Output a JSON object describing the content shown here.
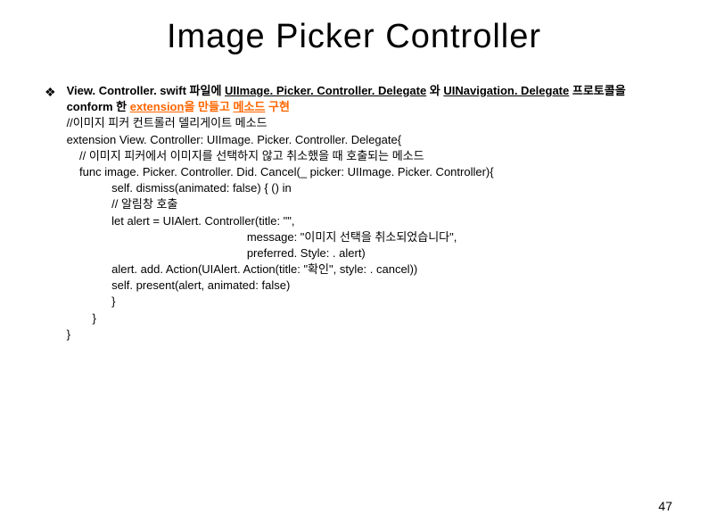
{
  "title": "Image Picker Controller",
  "bullet_char": "❖",
  "header": {
    "part1": "View. Controller. swift 파일에 ",
    "part2": "UIImage. Picker. Controller. Delegate",
    "part3": " 와 ",
    "part4": "UINavigation. Delegate",
    "part5": " 프로토콜을",
    "line2_part1": "conform 한 ",
    "line2_part2": "extension",
    "line2_part3": "을 만들고 ",
    "line2_part4": "메소드",
    "line2_part5": " 구현"
  },
  "code": {
    "line1": "//이미지 피커 컨트롤러 델리게이트 메소드",
    "line2": "extension View. Controller: UIImage. Picker. Controller. Delegate{",
    "line3": "    // 이미지 피커에서 이미지를 선택하지 않고 취소했을 때 호출되는 메소드",
    "line4": "    func image. Picker. Controller. Did. Cancel(_ picker: UIImage. Picker. Controller){",
    "line5": "              self. dismiss(animated: false) { () in",
    "line6": "              // 알림창 호출",
    "line7": "              let alert = UIAlert. Controller(title: \"\",",
    "line8": "                                                        message: \"이미지 선택을 취소되었습니다\",",
    "line9": "                                                        preferred. Style: . alert)",
    "line10": "              alert. add. Action(UIAlert. Action(title: \"확인\", style: . cancel))",
    "line11": "              self. present(alert, animated: false)",
    "line12": "              }",
    "line13": "        }",
    "line14": "}"
  },
  "page_number": "47"
}
